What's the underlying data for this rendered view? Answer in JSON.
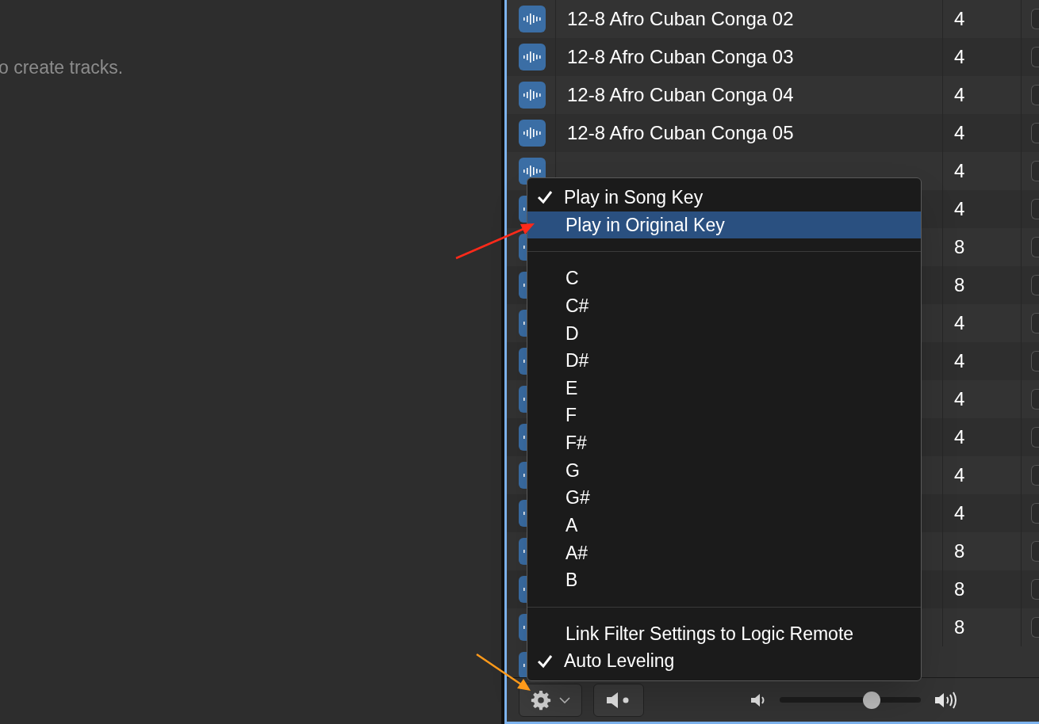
{
  "left_panel": {
    "hint": "o create tracks."
  },
  "loops": {
    "rows": [
      {
        "name": "12-8 Afro Cuban Conga 02",
        "beats": "4",
        "checked": false
      },
      {
        "name": "12-8 Afro Cuban Conga 03",
        "beats": "4",
        "checked": false
      },
      {
        "name": "12-8 Afro Cuban Conga 04",
        "beats": "4",
        "checked": false
      },
      {
        "name": "12-8 Afro Cuban Conga 05",
        "beats": "4",
        "checked": false
      },
      {
        "beats": "4",
        "checked": false
      },
      {
        "beats": "4",
        "checked": false
      },
      {
        "beats": "8",
        "checked": false
      },
      {
        "beats": "8",
        "checked": false
      },
      {
        "beats": "4",
        "checked": false
      },
      {
        "beats": "4",
        "checked": false
      },
      {
        "beats": "4",
        "checked": false
      },
      {
        "beats": "4",
        "checked": false
      },
      {
        "beats": "4",
        "checked": false
      },
      {
        "beats": "4",
        "checked": false
      },
      {
        "beats": "8",
        "checked": false
      },
      {
        "beats": "8",
        "checked": false
      },
      {
        "beats": "8",
        "checked": false
      }
    ]
  },
  "key_menu": {
    "sections": [
      [
        {
          "label": "Play in Song Key",
          "checked": true,
          "selected": false
        },
        {
          "label": "Play in Original Key",
          "checked": false,
          "selected": true
        }
      ],
      [
        {
          "label": "C",
          "checked": false,
          "selected": false
        },
        {
          "label": "C#",
          "checked": false,
          "selected": false
        },
        {
          "label": "D",
          "checked": false,
          "selected": false
        },
        {
          "label": "D#",
          "checked": false,
          "selected": false
        },
        {
          "label": "E",
          "checked": false,
          "selected": false
        },
        {
          "label": "F",
          "checked": false,
          "selected": false
        },
        {
          "label": "F#",
          "checked": false,
          "selected": false
        },
        {
          "label": "G",
          "checked": false,
          "selected": false
        },
        {
          "label": "G#",
          "checked": false,
          "selected": false
        },
        {
          "label": "A",
          "checked": false,
          "selected": false
        },
        {
          "label": "A#",
          "checked": false,
          "selected": false
        },
        {
          "label": "B",
          "checked": false,
          "selected": false
        }
      ],
      [
        {
          "label": "Link Filter Settings to Logic Remote",
          "checked": false,
          "selected": false
        },
        {
          "label": "Auto Leveling",
          "checked": true,
          "selected": false
        }
      ]
    ]
  },
  "footer": {
    "volume": {
      "level": 0.67
    }
  }
}
